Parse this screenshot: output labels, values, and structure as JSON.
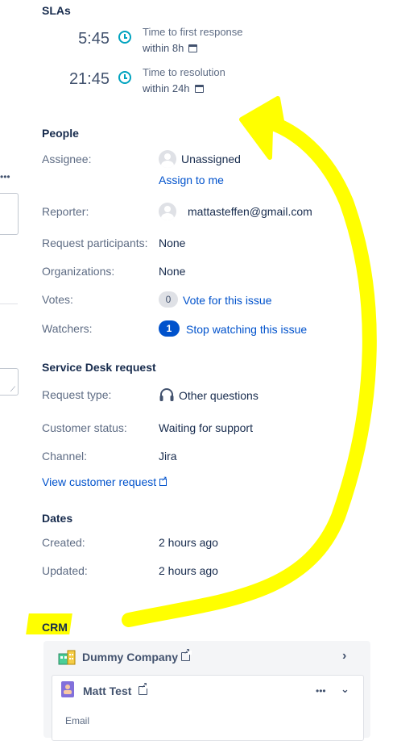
{
  "sla": {
    "heading": "SLAs",
    "items": [
      {
        "time": "5:45",
        "title": "Time to first response",
        "target": "within 8h"
      },
      {
        "time": "21:45",
        "title": "Time to resolution",
        "target": "within 24h"
      }
    ]
  },
  "left_column": {
    "more_icon": "•••"
  },
  "people": {
    "heading": "People",
    "assignee_label": "Assignee:",
    "assignee_value": "Unassigned",
    "assign_to_me": "Assign to me",
    "reporter_label": "Reporter:",
    "reporter_value": "mattasteffen@gmail.com",
    "participants_label": "Request participants:",
    "participants_value": "None",
    "organizations_label": "Organizations:",
    "organizations_value": "None",
    "votes_label": "Votes:",
    "votes_count": "0",
    "vote_link": "Vote for this issue",
    "watchers_label": "Watchers:",
    "watchers_count": "1",
    "watch_link": "Stop watching this issue"
  },
  "service_desk": {
    "heading": "Service Desk request",
    "request_type_label": "Request type:",
    "request_type_value": "Other questions",
    "customer_status_label": "Customer status:",
    "customer_status_value": "Waiting for support",
    "channel_label": "Channel:",
    "channel_value": "Jira",
    "view_request_link": "View customer request"
  },
  "dates": {
    "heading": "Dates",
    "created_label": "Created:",
    "created_value": "2 hours ago",
    "updated_label": "Updated:",
    "updated_value": "2 hours ago"
  },
  "crm": {
    "heading": "CRM",
    "company": "Dummy Company",
    "contact": "Matt Test",
    "contact_more": "•••",
    "email_label": "Email"
  },
  "colors": {
    "link": "#0052cc",
    "sla_clock": "#00a3bf",
    "annotation": "#ffff00"
  }
}
